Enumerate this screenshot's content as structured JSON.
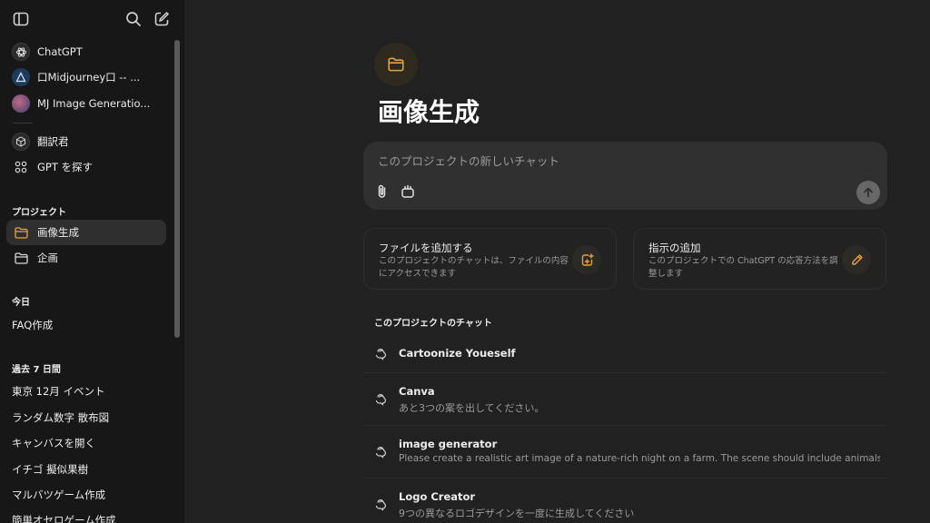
{
  "sidebar": {
    "gpts": [
      {
        "label": "ChatGPT",
        "icon": "openai-logo-icon"
      },
      {
        "label": "口Midjourney口 -- ...",
        "icon": "midjourney-avatar-icon"
      },
      {
        "label": "MJ Image Generatio...",
        "icon": "mj-image-avatar-icon"
      },
      {
        "label": "翻訳君",
        "icon": "translator-avatar-icon"
      },
      {
        "label": "GPT を探す",
        "icon": "grid-icon"
      }
    ],
    "projects_heading": "プロジェクト",
    "projects": [
      {
        "label": "画像生成",
        "active": true
      },
      {
        "label": "企画",
        "active": false
      }
    ],
    "today_heading": "今日",
    "today": [
      "FAQ作成"
    ],
    "week_heading": "過去 7 日間",
    "week": [
      "東京 12月 イベント",
      "ランダム数字 散布図",
      "キャンバスを開く",
      "イチゴ 擬似果樹",
      "マルバツゲーム作成",
      "簡単オセロゲーム作成"
    ]
  },
  "project": {
    "title": "画像生成",
    "accent_color": "#e8a33d"
  },
  "composer": {
    "placeholder": "このプロジェクトの新しいチャット"
  },
  "cards": [
    {
      "title": "ファイルを追加する",
      "description": "このプロジェクトのチャットは、ファイルの内容にアクセスできます"
    },
    {
      "title": "指示の追加",
      "description": "このプロジェクトでの ChatGPT の応答方法を調整します"
    }
  ],
  "chats_heading": "このプロジェクトのチャット",
  "chats": [
    {
      "title": "Cartoonize Youeself",
      "snippet": ""
    },
    {
      "title": "Canva",
      "snippet": "あと3つの案を出してください。"
    },
    {
      "title": "image generator",
      "snippet": "Please create a realistic art image of a nature-rich night on a farm. The scene should include animals..."
    },
    {
      "title": "Logo Creator",
      "snippet": "9つの異なるロゴデザインを一度に生成してください"
    }
  ]
}
